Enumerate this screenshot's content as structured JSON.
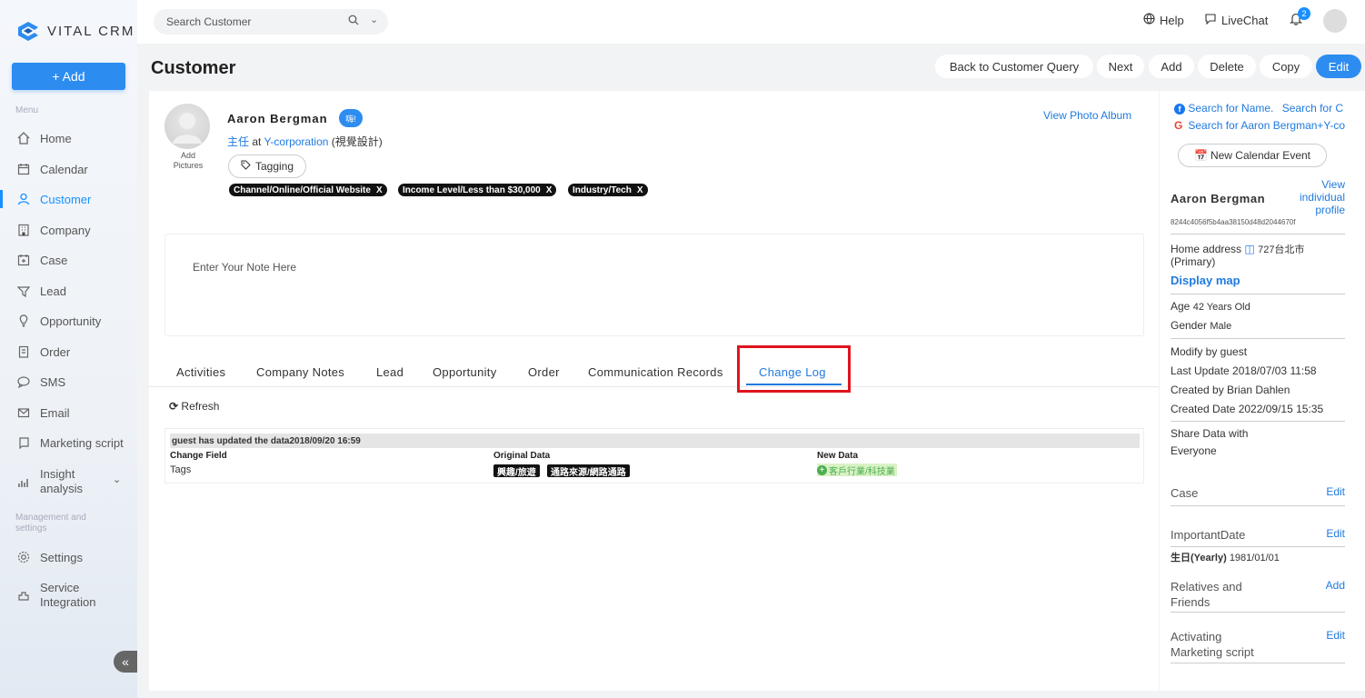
{
  "brand": {
    "name": "VITAL CRM",
    "accent": "#2d8cf0"
  },
  "sidebar": {
    "add_label": "+ Add",
    "menu_title": "Menu",
    "items": [
      {
        "label": "Home",
        "icon": "home-icon"
      },
      {
        "label": "Calendar",
        "icon": "calendar-icon"
      },
      {
        "label": "Customer",
        "icon": "user-icon",
        "active": true
      },
      {
        "label": "Company",
        "icon": "building-icon"
      },
      {
        "label": "Case",
        "icon": "case-icon"
      },
      {
        "label": "Lead",
        "icon": "lead-icon"
      },
      {
        "label": "Opportunity",
        "icon": "opportunity-icon"
      },
      {
        "label": "Order",
        "icon": "order-icon"
      },
      {
        "label": "SMS",
        "icon": "sms-icon"
      },
      {
        "label": "Email",
        "icon": "mail-icon"
      },
      {
        "label": "Marketing script",
        "icon": "script-icon"
      },
      {
        "label": "Insight analysis",
        "icon": "chart-icon"
      }
    ],
    "settings_title": "Management and settings",
    "settings_items": [
      {
        "label": "Settings",
        "icon": "gear-icon"
      },
      {
        "label": "Service Integration",
        "icon": "integration-icon"
      }
    ]
  },
  "topbar": {
    "search_placeholder": "Search Customer",
    "help": "Help",
    "livechat": "LiveChat",
    "notifications": "2"
  },
  "header": {
    "title": "Customer",
    "buttons": [
      "Back to Customer Query",
      "Next",
      "Add",
      "Delete",
      "Copy",
      "Edit"
    ]
  },
  "profile": {
    "name": "Aaron Bergman",
    "badge": "嗨!",
    "add_pictures": "Add Pictures",
    "role": "主任",
    "at": "at",
    "company": "Y-corporation",
    "dept": "(視覺設計)",
    "tagging": "Tagging",
    "tags": [
      "Channel/Online/Official Website",
      "Income Level/Less than $30,000",
      "Industry/Tech"
    ],
    "tag_remove": "X",
    "view_album": "View Photo Album",
    "note_placeholder": "Enter Your Note Here"
  },
  "tabs": [
    "Activities",
    "Company Notes",
    "Lead",
    "Opportunity",
    "Order",
    "Communication Records",
    "Change Log"
  ],
  "changelog": {
    "refresh": "Refresh",
    "entry_header": "guest has updated the data2018/09/20 16:59",
    "col_field": "Change Field",
    "col_original": "Original Data",
    "col_new": "New Data",
    "field_value": "Tags",
    "original_tags": [
      "興趣/旅遊",
      "通路來源/網路通路"
    ],
    "new_tag": "客戶行業/科技業"
  },
  "right": {
    "search_name": "Search for Name.",
    "search_for": "Search for C",
    "search_google": "Search for Aaron Bergman+Y-co",
    "calendar_event": "New Calendar Event",
    "name": "Aaron Bergman",
    "view_profile": "View individual profile",
    "id": "8244c4056f5b4aa38150d48d2044670f",
    "home_address_label": "Home address",
    "home_address_value": "727台北市",
    "primary": "(Primary)",
    "display_map": "Display map",
    "age_label": "Age",
    "age_value": "42 Years Old",
    "gender_label": "Gender",
    "gender_value": "Male",
    "modify_by": "Modify by guest",
    "last_update": "Last Update 2018/07/03 11:58",
    "created_by": "Created by Brian Dahlen",
    "created_date": "Created Date 2022/09/15 15:35",
    "share_label": "Share Data with",
    "share_value": "Everyone",
    "case_label": "Case",
    "case_action": "Edit",
    "important_label": "ImportantDate",
    "important_action": "Edit",
    "birthday_label": "生日(Yearly)",
    "birthday_value": "1981/01/01",
    "relatives_label": "Relatives and Friends",
    "relatives_action": "Add",
    "activating_label": "Activating Marketing script",
    "activating_action": "Edit"
  }
}
